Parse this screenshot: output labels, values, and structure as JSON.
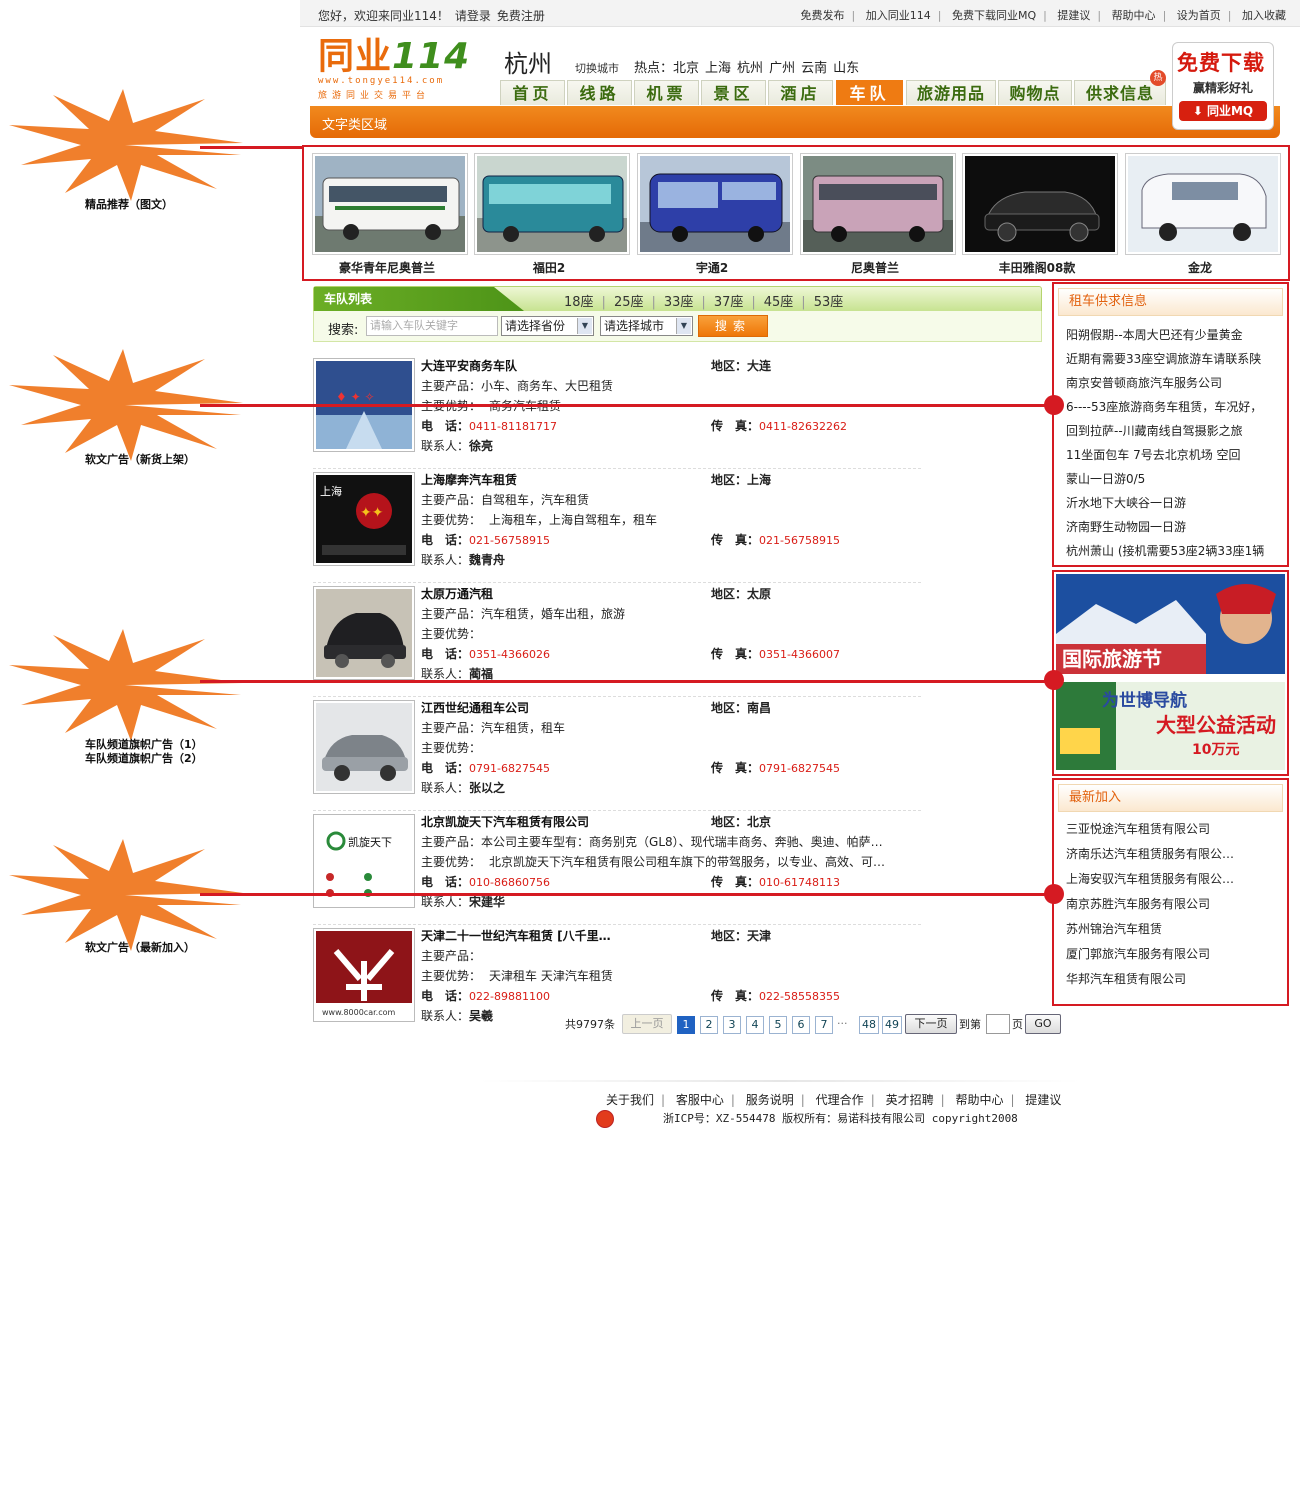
{
  "topbar": {
    "welcome": "您好，欢迎来同业114！",
    "login": "请登录",
    "register": "免费注册",
    "links": [
      "免费发布",
      "加入同业114",
      "免费下载同业MQ",
      "提建议",
      "帮助中心",
      "设为首页",
      "加入收藏"
    ]
  },
  "header": {
    "logo_main": "同业",
    "logo_num": "114",
    "logo_url": "www.tongye114.com",
    "logo_tagline": "旅游同业交易平台",
    "city": "杭州",
    "switch_city": "切换城市",
    "hot_label": "热点：",
    "hot_cities": [
      "北京",
      "上海",
      "杭州",
      "广州",
      "云南",
      "山东"
    ]
  },
  "nav": {
    "tabs": [
      "首页",
      "线路",
      "机票",
      "景区",
      "酒店",
      "车队",
      "旅游用品",
      "购物点",
      "供求信息"
    ],
    "active_index": 5,
    "hot_badge": "热"
  },
  "orange_bar": {
    "label": "文字类区域"
  },
  "mq_ad": {
    "line1": "免费下载",
    "line2": "赢精彩好礼",
    "line3": "同业MQ"
  },
  "featured": {
    "items": [
      {
        "label": "豪华青年尼奥普兰",
        "color": "#e9eef2"
      },
      {
        "label": "福田2",
        "color": "#2a8a9a"
      },
      {
        "label": "宇通2",
        "color": "#2e3fa8"
      },
      {
        "label": "尼奥普兰",
        "color": "#c9a3b8"
      },
      {
        "label": "丰田雅阁08款",
        "color": "#1a1a1a"
      },
      {
        "label": "金龙",
        "color": "#f0f2f4"
      }
    ]
  },
  "list": {
    "title": "车队列表",
    "seats": [
      "18座",
      "25座",
      "33座",
      "37座",
      "45座",
      "53座"
    ],
    "search_label": "搜索:",
    "search_placeholder": "请输入车队关键字",
    "province_select": "请选择省份",
    "city_select": "请选择城市",
    "search_button": "搜索",
    "labels": {
      "region": "地区：",
      "product": "主要产品：",
      "advantage": "主要优势：",
      "phone": "电　话：",
      "fax": "传　真：",
      "contact": "联系人："
    },
    "items": [
      {
        "name": "大连平安商务车队",
        "region": "大连",
        "product": "小车、商务车、大巴租赁",
        "advantage": "商务汽车租赁",
        "phone": "0411-81181717",
        "fax": "0411-82632262",
        "contact": "徐亮"
      },
      {
        "name": "上海摩奔汽车租赁",
        "region": "上海",
        "product": "自驾租车，汽车租赁",
        "advantage": "上海租车，上海自驾租车，租车",
        "phone": "021-56758915",
        "fax": "021-56758915",
        "contact": "魏青舟"
      },
      {
        "name": "太原万通汽租",
        "region": "太原",
        "product": "汽车租赁，婚车出租，旅游",
        "advantage": "",
        "phone": "0351-4366026",
        "fax": "0351-4366007",
        "contact": "蔺福"
      },
      {
        "name": "江西世纪通租车公司",
        "region": "南昌",
        "product": "汽车租赁，租车",
        "advantage": "",
        "phone": "0791-6827545",
        "fax": "0791-6827545",
        "contact": "张以之"
      },
      {
        "name": "北京凯旋天下汽车租赁有限公司",
        "region": "北京",
        "product": "本公司主要车型有：商务别克（GL8）、现代瑞丰商务、奔驰、奥迪、帕萨…",
        "advantage": "北京凯旋天下汽车租赁有限公司租车旗下的带驾服务，以专业、高效、可…",
        "phone": "010-86860756",
        "fax": "010-61748113",
        "contact": "宋建华"
      },
      {
        "name": "天津二十一世纪汽车租赁 [八千里…",
        "region": "天津",
        "product": "",
        "advantage": "天津租车 天津汽车租赁",
        "phone": "022-89881100",
        "fax": "022-58558355",
        "contact": "吴羲"
      }
    ]
  },
  "thumb_texts": {
    "shanghai": "上海",
    "kaixuan": "凯旋天下",
    "site": "www.8000car.com"
  },
  "pager": {
    "total": "共9797条",
    "prev": "上一页",
    "pages": [
      "1",
      "2",
      "3",
      "4",
      "5",
      "6",
      "7"
    ],
    "ellipsis": "···",
    "last_pages": [
      "48",
      "49"
    ],
    "next": "下一页",
    "goto_prefix": "到第",
    "goto_suffix": "页",
    "go": "GO"
  },
  "sidebar": {
    "supply": {
      "title": "租车供求信息",
      "items": [
        "阳朔假期--本周大巴还有少量黄金",
        "近期有需要33座空调旅游车请联系陕",
        "南京安普顿商旅汽车服务公司",
        "6----53座旅游商务车租赁，车况好，",
        "回到拉萨--川藏南线自驾摄影之旅",
        "11坐面包车 7号去北京机场 空回",
        "蒙山一日游0/5",
        "沂水地下大峡谷一日游",
        "济南野生动物园一日游",
        "杭州萧山 (接机需要53座2辆33座1辆"
      ]
    },
    "banner1": "国际旅游节",
    "banner2_line1": "为世博导航",
    "banner2_line2": "大型公益活动",
    "banner2_line3": "10万元",
    "newest": {
      "title": "最新加入",
      "items": [
        "三亚悦途汽车租赁有限公司",
        "济南乐达汽车租赁服务有限公…",
        "上海安驭汽车租赁服务有限公…",
        "南京苏胜汽车服务有限公司",
        "苏州锦治汽车租赁",
        "厦门郭旅汽车服务有限公司",
        "华邦汽车租赁有限公司"
      ]
    }
  },
  "annotations": [
    "精品推荐（图文）",
    "软文广告（新货上架）",
    "车队频道旗帜广告（1）",
    "车队频道旗帜广告（2）",
    "软文广告（最新加入）"
  ],
  "footer": {
    "links": [
      "关于我们",
      "客服中心",
      "服务说明",
      "代理合作",
      "英才招聘",
      "帮助中心",
      "提建议"
    ],
    "copyright": "浙ICP号：XZ-554478 版权所有：易诺科技有限公司 copyright2008"
  },
  "colors": {
    "accent_orange": "#ef7b12",
    "annotation_red": "#d51a22",
    "nav_green": "#3b6b0f",
    "phone_red": "#d91d16"
  }
}
